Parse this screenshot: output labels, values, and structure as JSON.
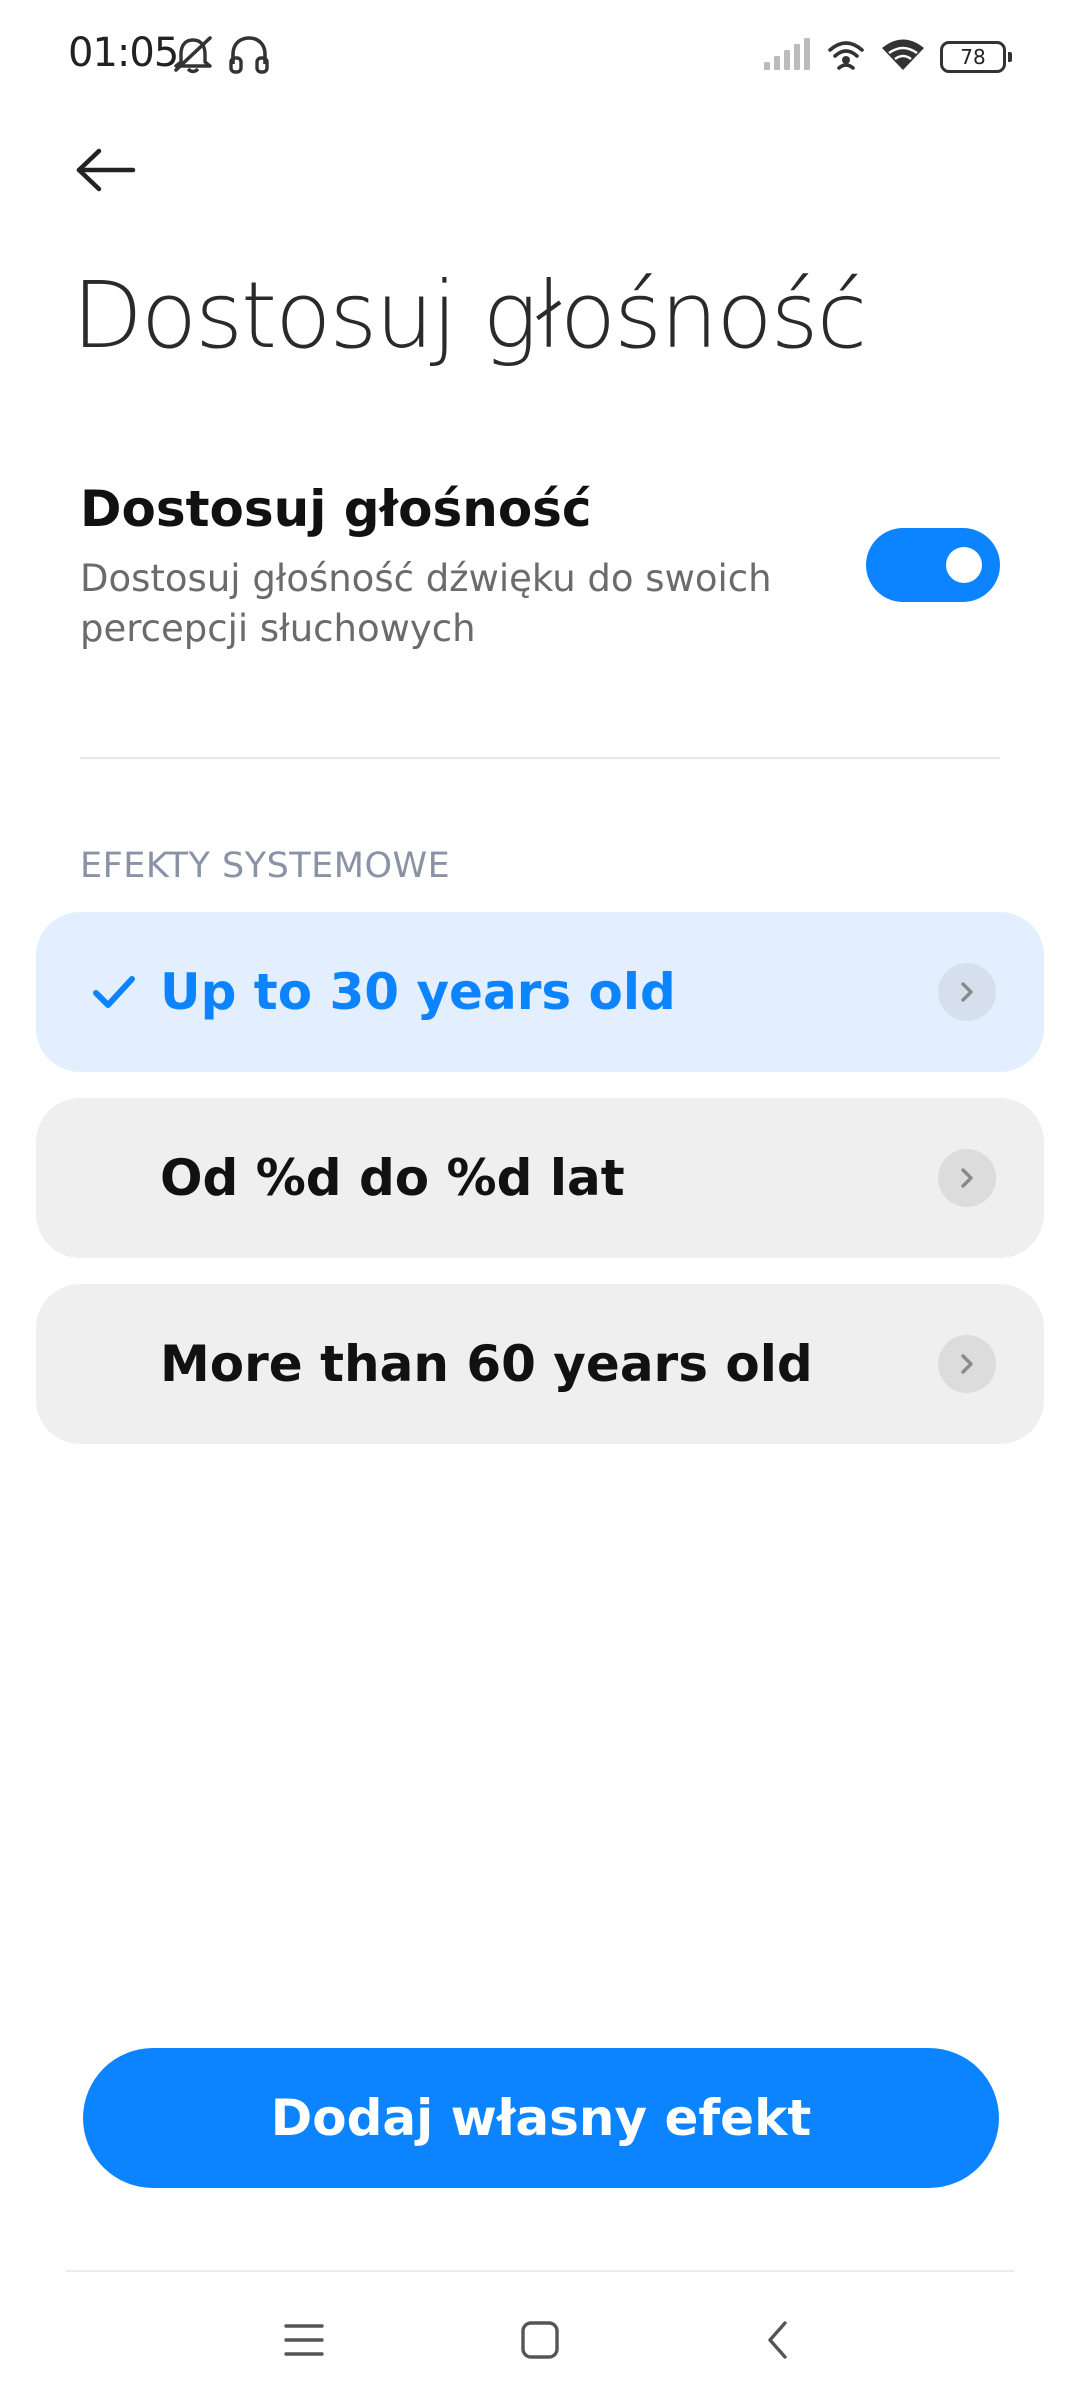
{
  "status_bar": {
    "time": "01:05",
    "battery": "78"
  },
  "page": {
    "title": "Dostosuj głośność"
  },
  "setting": {
    "title": "Dostosuj głośność",
    "description": "Dostosuj głośność dźwięku do swoich percepcji słuchowych",
    "enabled": true
  },
  "section": {
    "header": "EFEKTY SYSTEMOWE"
  },
  "options": [
    {
      "label": "Up to 30 years old",
      "selected": true
    },
    {
      "label": "Od %d do %d lat",
      "selected": false
    },
    {
      "label": "More than 60 years old",
      "selected": false
    }
  ],
  "primary_button": {
    "label": "Dodaj własny efekt"
  },
  "colors": {
    "accent": "#0d84ff",
    "selected_bg": "#e3effe",
    "card_bg": "#efefef"
  },
  "icons": [
    "back-arrow-icon",
    "mute-icon",
    "headphones-icon",
    "signal-icon",
    "hotspot-icon",
    "wifi-icon",
    "battery-icon",
    "check-icon",
    "chevron-right-icon",
    "menu-icon",
    "home-icon",
    "back-icon"
  ]
}
